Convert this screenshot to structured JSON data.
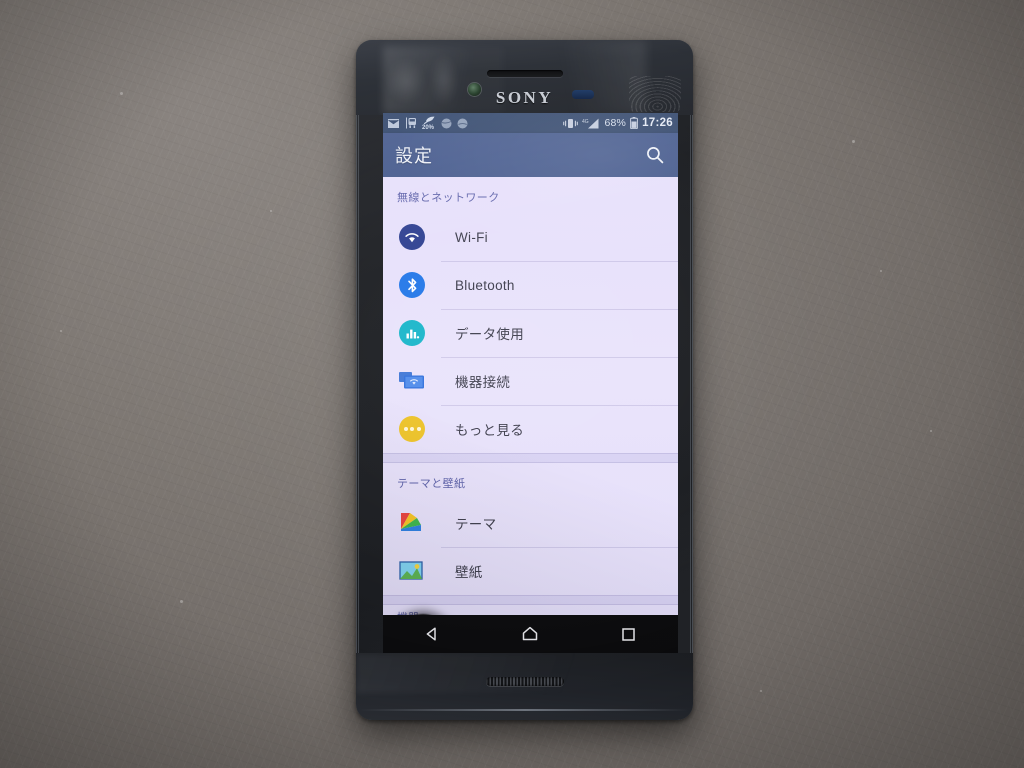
{
  "device": {
    "brand": "SONY",
    "hardware": {
      "earpiece": "earpiece-speaker",
      "front_camera": "front-camera",
      "proximity_sensor": "proximity-sensor",
      "bottom_speaker": "bottom-speaker"
    }
  },
  "statusbar": {
    "left_icons": [
      {
        "name": "mail-icon",
        "glyph": "mail"
      },
      {
        "name": "transit-icon",
        "glyph": "train"
      },
      {
        "name": "battery-saver-icon",
        "glyph": "leaf",
        "label": "20%"
      },
      {
        "name": "notification-circle-icon-1",
        "glyph": "circle"
      },
      {
        "name": "notification-circle-icon-2",
        "glyph": "circle"
      }
    ],
    "vibrate_icon": "vibrate-icon",
    "network_type": "4G",
    "signal_icon": "signal-bars-icon",
    "battery_percent": "68%",
    "battery_icon": "battery-icon",
    "time": "17:26"
  },
  "appbar": {
    "title": "設定",
    "search_icon": "search-icon"
  },
  "settings": {
    "sections": [
      {
        "header": "無線とネットワーク",
        "items": [
          {
            "label": "Wi-Fi",
            "icon": "wifi-icon",
            "icon_color": "#2b3d8f"
          },
          {
            "label": "Bluetooth",
            "icon": "bluetooth-icon",
            "icon_color": "#2176e8"
          },
          {
            "label": "データ使用",
            "icon": "data-usage-icon",
            "icon_color": "#17b5c9"
          },
          {
            "label": "機器接続",
            "icon": "device-connection-icon",
            "icon_color": "#2f6fdb"
          },
          {
            "label": "もっと見る",
            "icon": "more-icon",
            "icon_color": "#edc225"
          }
        ]
      },
      {
        "header": "テーマと壁紙",
        "items": [
          {
            "label": "テーマ",
            "icon": "theme-icon",
            "icon_color": "#e8413c"
          },
          {
            "label": "壁紙",
            "icon": "wallpaper-icon",
            "icon_color": "#4c9c4a"
          }
        ]
      },
      {
        "header": "機器",
        "items": []
      }
    ]
  },
  "navbar": {
    "back": "back-icon",
    "home": "home-icon",
    "recents": "recents-icon"
  },
  "colors": {
    "statusbar_bg": "#2d4268",
    "appbar_bg": "#41568a",
    "list_bg": "#e9e3fb",
    "section_header_text": "#5b5fa8",
    "row_label_text": "#3b3b4a",
    "navbar_bg": "#0a0a0c"
  }
}
